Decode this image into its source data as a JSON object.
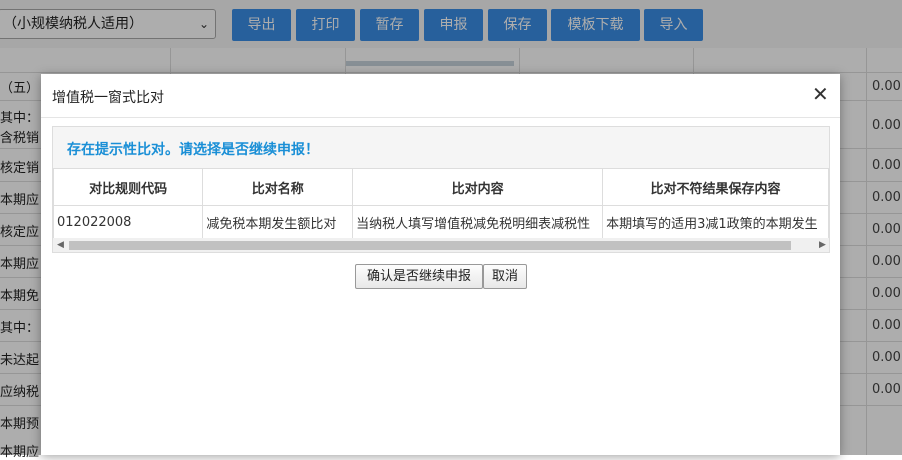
{
  "toolbar": {
    "select_value": "（小规模纳税人适用）",
    "buttons": [
      "导出",
      "打印",
      "暂存",
      "申报",
      "保存",
      "模板下载",
      "导入"
    ]
  },
  "background": {
    "row_labels": [
      "（五）",
      "其中：",
      "含税销",
      "核定销",
      "本期应",
      "核定应",
      "本期应",
      "本期免",
      "其中：",
      "未达起",
      "应纳税",
      "本期预",
      "本期应"
    ],
    "values": [
      "0.00",
      "0.00",
      "0.00",
      "0.00",
      "0.00",
      "0.00",
      "0.00",
      "0.00",
      "0.00",
      "0.00"
    ]
  },
  "dialog": {
    "title": "增值税一窗式比对",
    "close_glyph": "✕",
    "warning": "存在提示性比对。请选择是否继续申报！",
    "columns": [
      "对比规则代码",
      "比对名称",
      "比对内容",
      "比对不符结果保存内容"
    ],
    "rows": [
      [
        "012022008",
        "减免税本期发生额比对",
        "当纳税人填写增值税减免税明细表减税性",
        "本期填写的适用3减1政策的本期发生"
      ]
    ],
    "confirm_label": "确认是否继续申报",
    "cancel_label": "取消"
  },
  "colors": {
    "primary": "#3a8ee6",
    "warning_text": "#1a8fd6"
  }
}
